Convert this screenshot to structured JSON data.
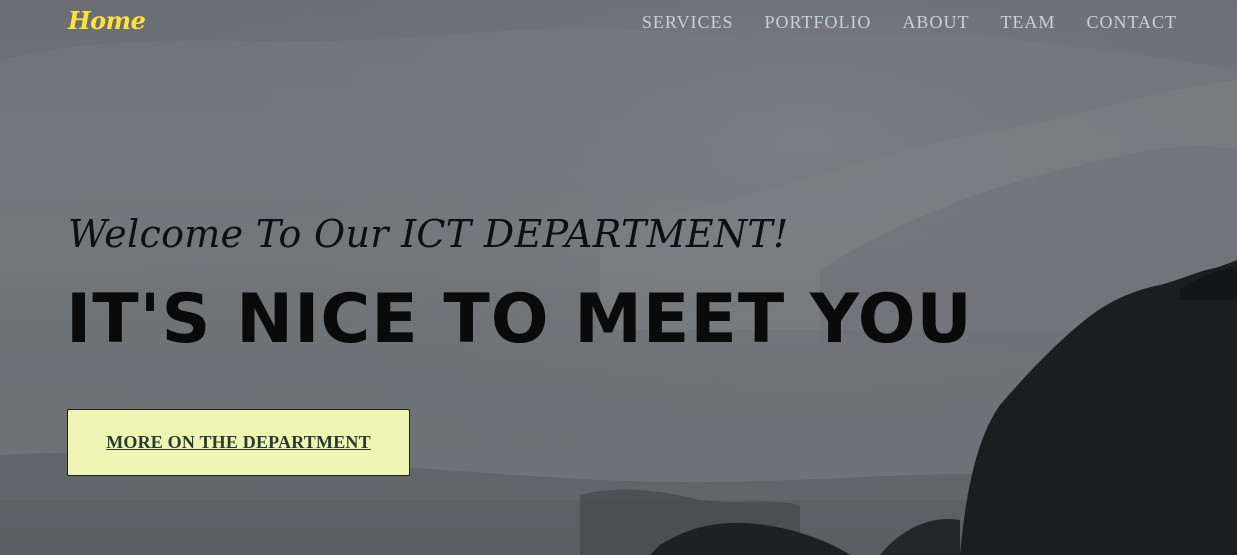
{
  "nav": {
    "brand": "Home",
    "links": [
      {
        "label": "SERVICES"
      },
      {
        "label": "PORTFOLIO"
      },
      {
        "label": "ABOUT"
      },
      {
        "label": "TEAM"
      },
      {
        "label": "CONTACT"
      }
    ]
  },
  "hero": {
    "subheading": "Welcome To Our ICT DEPARTMENT!",
    "heading": "IT'S NICE TO MEET YOU",
    "cta_label": "MORE ON THE DEPARTMENT",
    "background": "misty-coast-mountains-photo"
  },
  "colors": {
    "brand": "#ffe23b",
    "nav_link": "#c3d3de",
    "cta_bg": "#eef4b4",
    "cta_text": "#2b3a2e"
  }
}
